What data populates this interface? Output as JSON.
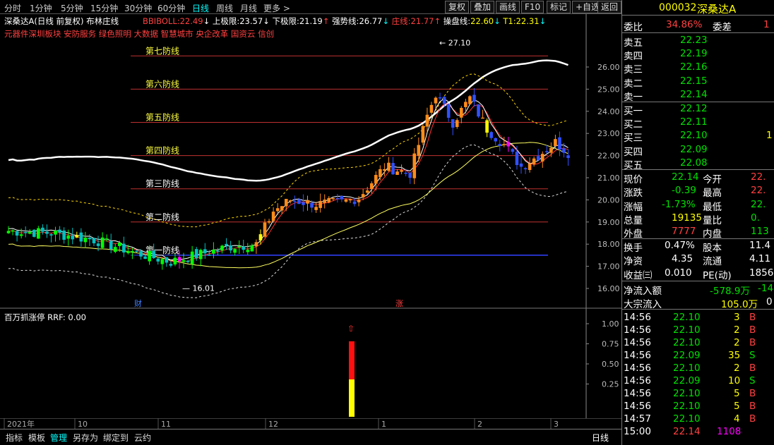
{
  "toolbar": {
    "timeframes": [
      "分时",
      "1分钟",
      "5分钟",
      "15分钟",
      "30分钟",
      "60分钟",
      "日线",
      "周线",
      "月线",
      "更多 >"
    ],
    "active_timeframe": "日线",
    "buttons": [
      "复权",
      "叠加",
      "画线",
      "F10",
      "标记",
      "+自选",
      "返回"
    ]
  },
  "main_panel": {
    "stock_title": "深桑达A(日线 前复权) 布林庄线",
    "indicators": {
      "bbiboll": {
        "label": "BBIBOLL:",
        "value": "22.49",
        "arrow": "↓"
      },
      "upper": {
        "label": "上极限:",
        "value": "23.57",
        "arrow": "↓"
      },
      "lower": {
        "label": "下极限:",
        "value": "21.19",
        "arrow": "↑"
      },
      "strong": {
        "label": "强势线:",
        "value": "26.77",
        "arrow": "↓"
      },
      "zhuang": {
        "label": "庄线:",
        "value": "21.77",
        "arrow": "↑"
      },
      "caopan": {
        "label": "操盘线:",
        "value": "22.60",
        "arrow": "↓"
      },
      "t1": {
        "label": "T1:",
        "value": "22.31",
        "arrow": "↓"
      }
    },
    "concepts_line": "元器件深圳板块    安防服务 绿色照明 大数据 智慧城市 央企改革 国资云 信创",
    "defense_lines": [
      "第七防线",
      "第六防线",
      "第五防线",
      "第四防线",
      "第三防线",
      "第二防线",
      "第一防线"
    ],
    "price_axis": [
      "26.00",
      "25.00",
      "24.00",
      "23.00",
      "22.00",
      "21.00",
      "20.00",
      "19.00",
      "18.00",
      "17.00",
      "16.00"
    ],
    "high_label": "27.10",
    "low_label": "16.01",
    "markers": {
      "cai": "财",
      "zhang": "涨"
    }
  },
  "sub_panel": {
    "title": "百万抓涨停 RRF: 0.00",
    "axis": [
      "1.00",
      "0.75",
      "0.50",
      "0.25"
    ]
  },
  "date_axis": [
    "2021年",
    "10",
    "11",
    "12",
    "1",
    "2",
    "3"
  ],
  "period_label": "日线",
  "bottom_tabs": [
    "指标",
    "模板",
    "管理",
    "另存为",
    "绑定到",
    "云约"
  ],
  "active_bottom_tab": "管理",
  "quote": {
    "code": "000032",
    "name": "深桑达A",
    "weibi_label": "委比",
    "weibi_value": "34.86%",
    "weicha_label": "委差",
    "weicha_value": "1",
    "asks": [
      {
        "label": "卖五",
        "price": "22.23",
        "vol": ""
      },
      {
        "label": "卖四",
        "price": "22.19",
        "vol": ""
      },
      {
        "label": "卖三",
        "price": "22.16",
        "vol": ""
      },
      {
        "label": "卖二",
        "price": "22.15",
        "vol": ""
      },
      {
        "label": "卖一",
        "price": "22.14",
        "vol": ""
      }
    ],
    "bids": [
      {
        "label": "买一",
        "price": "22.12",
        "vol": ""
      },
      {
        "label": "买二",
        "price": "22.11",
        "vol": ""
      },
      {
        "label": "买三",
        "price": "22.10",
        "vol": "1"
      },
      {
        "label": "买四",
        "price": "22.09",
        "vol": ""
      },
      {
        "label": "买五",
        "price": "22.08",
        "vol": ""
      }
    ],
    "stats": [
      {
        "l1": "现价",
        "v1": "22.14",
        "c1": "green",
        "l2": "今开",
        "v2": "22.",
        "c2": "red"
      },
      {
        "l1": "涨跌",
        "v1": "-0.39",
        "c1": "green",
        "l2": "最高",
        "v2": "22.",
        "c2": "red"
      },
      {
        "l1": "涨幅",
        "v1": "-1.73%",
        "c1": "green",
        "l2": "最低",
        "v2": "22.",
        "c2": "green"
      },
      {
        "l1": "总量",
        "v1": "19135",
        "c1": "yellow",
        "l2": "量比",
        "v2": "0.",
        "c2": "green"
      },
      {
        "l1": "外盘",
        "v1": "7777",
        "c1": "red",
        "l2": "内盘",
        "v2": "113",
        "c2": "green"
      }
    ],
    "stats2": [
      {
        "l1": "换手",
        "v1": "0.47%",
        "l2": "股本",
        "v2": "11.4"
      },
      {
        "l1": "净资",
        "v1": "4.35",
        "l2": "流通",
        "v2": "4.11"
      },
      {
        "l1": "收益㈢",
        "v1": "0.010",
        "l2": "PE(动)",
        "v2": "1856"
      }
    ],
    "netflow_label": "净流入额",
    "netflow_value": "-578.9万",
    "netflow_extra": "-14",
    "block_label": "大宗流入",
    "block_value": "105.0万",
    "block_extra": "0",
    "ticks": [
      {
        "t": "14:56",
        "p": "22.10",
        "v": "3",
        "d": "B"
      },
      {
        "t": "14:56",
        "p": "22.10",
        "v": "2",
        "d": "B"
      },
      {
        "t": "14:56",
        "p": "22.10",
        "v": "2",
        "d": "B"
      },
      {
        "t": "14:56",
        "p": "22.09",
        "v": "35",
        "d": "S"
      },
      {
        "t": "14:56",
        "p": "22.10",
        "v": "2",
        "d": "B"
      },
      {
        "t": "14:56",
        "p": "22.09",
        "v": "10",
        "d": "S"
      },
      {
        "t": "14:56",
        "p": "22.10",
        "v": "5",
        "d": "B"
      },
      {
        "t": "14:56",
        "p": "22.10",
        "v": "5",
        "d": "B"
      },
      {
        "t": "14:57",
        "p": "22.10",
        "v": "4",
        "d": "B"
      },
      {
        "t": "15:00",
        "p": "22.14",
        "v": "1108",
        "d": ""
      }
    ]
  },
  "colors": {
    "up": "#ff3030",
    "down": "#00ff00",
    "yellow_candle": "#ffff00",
    "orange": "#ff8c1a",
    "blue": "#3050ff",
    "magenta": "#ff00ff"
  }
}
